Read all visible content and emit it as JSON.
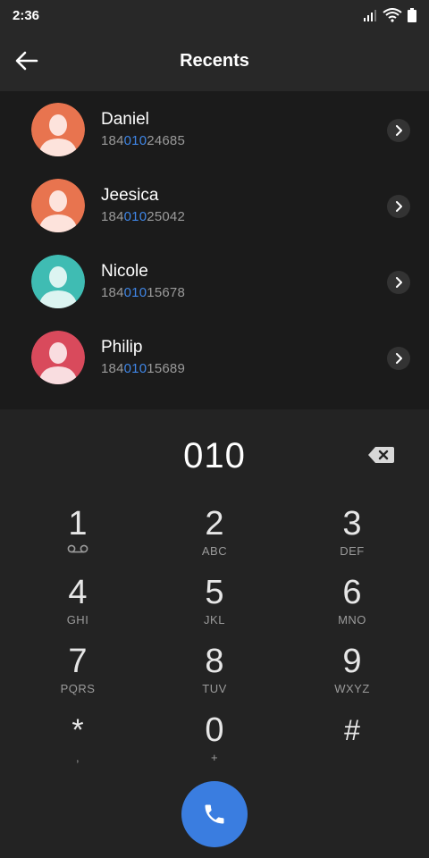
{
  "status_bar": {
    "time": "2:36"
  },
  "app_bar": {
    "title": "Recents"
  },
  "contacts": [
    {
      "name": "Daniel",
      "number_prefix": "184",
      "number_match": "010",
      "number_suffix": "24685",
      "avatar_color": "#e8744f"
    },
    {
      "name": "Jeesica",
      "number_prefix": "184",
      "number_match": "010",
      "number_suffix": "25042",
      "avatar_color": "#e8744f"
    },
    {
      "name": "Nicole",
      "number_prefix": "184",
      "number_match": "010",
      "number_suffix": "15678",
      "avatar_color": "#3fbcb3"
    },
    {
      "name": "Philip",
      "number_prefix": "184",
      "number_match": "010",
      "number_suffix": "15689",
      "avatar_color": "#d94a5c"
    }
  ],
  "dialpad": {
    "entry": "010",
    "keys": [
      {
        "digit": "1",
        "letters": ""
      },
      {
        "digit": "2",
        "letters": "ABC"
      },
      {
        "digit": "3",
        "letters": "DEF"
      },
      {
        "digit": "4",
        "letters": "GHI"
      },
      {
        "digit": "5",
        "letters": "JKL"
      },
      {
        "digit": "6",
        "letters": "MNO"
      },
      {
        "digit": "7",
        "letters": "PQRS"
      },
      {
        "digit": "8",
        "letters": "TUV"
      },
      {
        "digit": "9",
        "letters": "WXYZ"
      },
      {
        "digit": "*",
        "letters": ","
      },
      {
        "digit": "0",
        "letters": "+"
      },
      {
        "digit": "#",
        "letters": ""
      }
    ]
  },
  "colors": {
    "accent": "#3a7de0",
    "highlight": "#3f86e6",
    "background": "#1f1f1f"
  },
  "icons": {
    "back": "arrow-left-icon",
    "backspace": "backspace-icon",
    "call": "phone-icon",
    "voicemail": "voicemail-icon",
    "chevron": "chevron-right-icon"
  }
}
